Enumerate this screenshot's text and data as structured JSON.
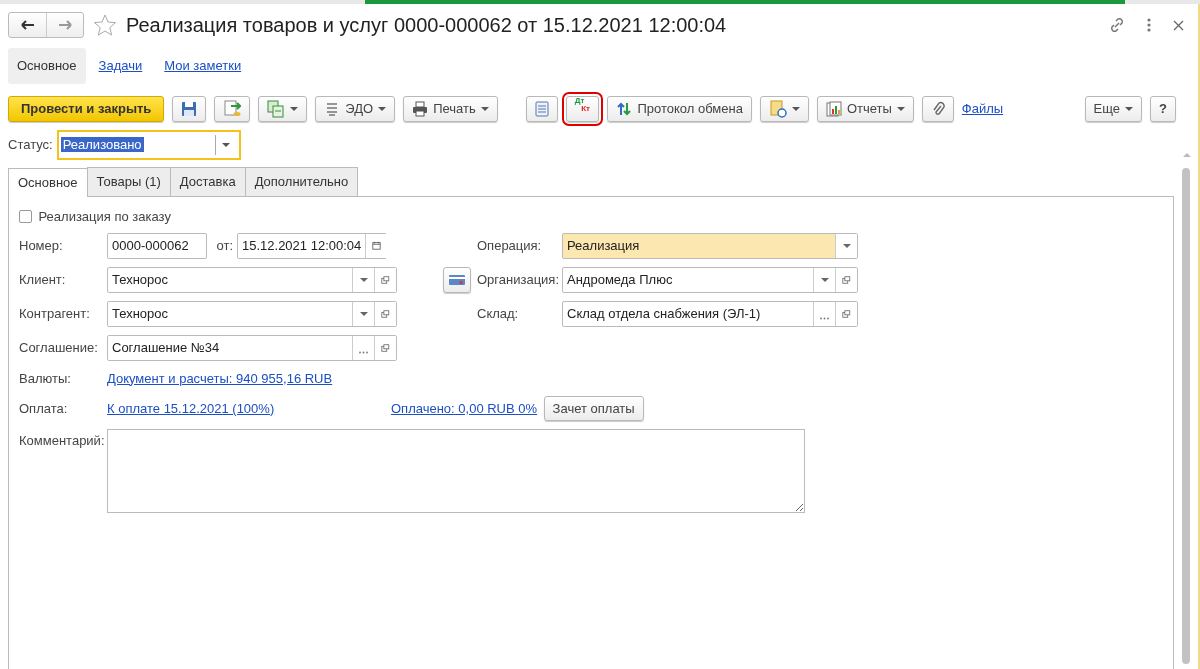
{
  "header": {
    "title": "Реализация товаров и услуг 0000-000062 от 15.12.2021 12:00:04",
    "favorite": false
  },
  "view_tabs": [
    {
      "label": "Основное",
      "selected": true
    },
    {
      "label": "Задачи",
      "selected": false
    },
    {
      "label": "Мои заметки",
      "selected": false
    }
  ],
  "toolbar": {
    "post_close": "Провести и закрыть",
    "edo": "ЭДО",
    "print": "Печать",
    "dt_kt": {
      "debit": "Дт",
      "credit": "Кт",
      "highlighted": true
    },
    "exchange": "Протокол обмена",
    "reports": "Отчеты",
    "files": "Файлы",
    "more": "Еще",
    "help": "?"
  },
  "status": {
    "label": "Статус:",
    "value": "Реализовано",
    "focused": true
  },
  "form_tabs": [
    {
      "label": "Основное",
      "selected": true
    },
    {
      "label": "Товары (1)",
      "selected": false
    },
    {
      "label": "Доставка",
      "selected": false
    },
    {
      "label": "Дополнительно",
      "selected": false
    }
  ],
  "by_order": {
    "label": "Реализация по заказу",
    "checked": false
  },
  "number": {
    "label": "Номер:",
    "value": "0000-000062"
  },
  "date": {
    "label": "от:",
    "value": "15.12.2021 12:00:04"
  },
  "operation": {
    "label": "Операция:",
    "value": "Реализация",
    "highlighted": true
  },
  "client": {
    "label": "Клиент:",
    "value": "Технорос"
  },
  "organization": {
    "label": "Организация:",
    "value": "Андромеда Плюс"
  },
  "counterparty": {
    "label": "Контрагент:",
    "value": "Технорос"
  },
  "warehouse": {
    "label": "Склад:",
    "value": "Склад отдела снабжения (ЭЛ-1)"
  },
  "agreement": {
    "label": "Соглашение:",
    "value": "Соглашение №34"
  },
  "currencies": {
    "label": "Валюты:",
    "link": "Документ и расчеты: 940 955,16 RUB"
  },
  "payment": {
    "label": "Оплата:",
    "link": "К оплате 15.12.2021 (100%)",
    "paid_link": "Оплачено: 0,00 RUB 0%",
    "offset_button": "Зачет оплаты"
  },
  "comment": {
    "label": "Комментарий:"
  }
}
